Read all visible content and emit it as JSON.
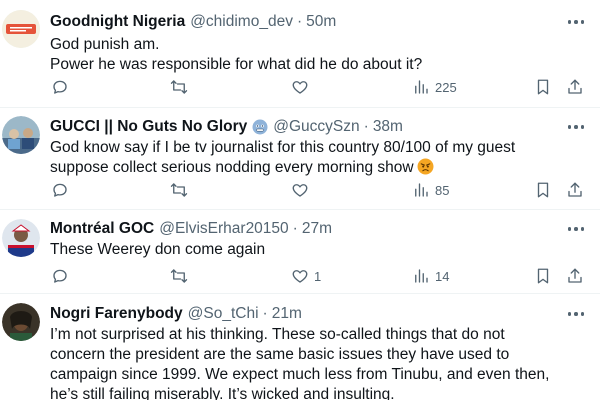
{
  "tweets": [
    {
      "name": "Goodnight Nigeria",
      "handle": "@chidimo_dev",
      "dot": "·",
      "time": "50m",
      "lines": [
        "God punish am.",
        "Power he was responsible for what did he do about it?"
      ],
      "metrics": {
        "replies": "",
        "retweets": "",
        "likes": "",
        "views": "225"
      }
    },
    {
      "name": "GUCCI || No Guts No Glory",
      "handle": "@GuccySzn",
      "dot": "·",
      "time": "38m",
      "badge_icon": "face-emoji-icon",
      "lines": [
        "God know say if I be tv journalist for this country 80/100 of my guest",
        "suppose collect serious nodding every morning show"
      ],
      "line_emoji": "angry-face-emoji",
      "metrics": {
        "replies": "",
        "retweets": "",
        "likes": "",
        "views": "85"
      }
    },
    {
      "name": "Montréal GOC",
      "handle": "@ElvisErhar20150",
      "dot": "·",
      "time": "27m",
      "lines": [
        "These Weerey don come again"
      ],
      "metrics": {
        "replies": "",
        "retweets": "",
        "likes": "1",
        "views": "14"
      }
    },
    {
      "name": "Nogri Farenybody",
      "handle": "@So_tChi",
      "dot": "·",
      "time": "21m",
      "lines": [
        "I’m not surprised at his thinking. These so-called things that do not",
        "concern the president are the same basic issues they have used to",
        "campaign since 1999. We expect much less from Tinubu, and even then,",
        "he’s still failing miserably. It’s wicked and insulting."
      ],
      "metrics": {
        "replies": "",
        "retweets": "",
        "likes": "",
        "views": ""
      }
    }
  ],
  "colors": {
    "text": "#0f1419",
    "muted": "#536471",
    "divider": "#eff3f4",
    "accent": "#1d9bf0"
  }
}
